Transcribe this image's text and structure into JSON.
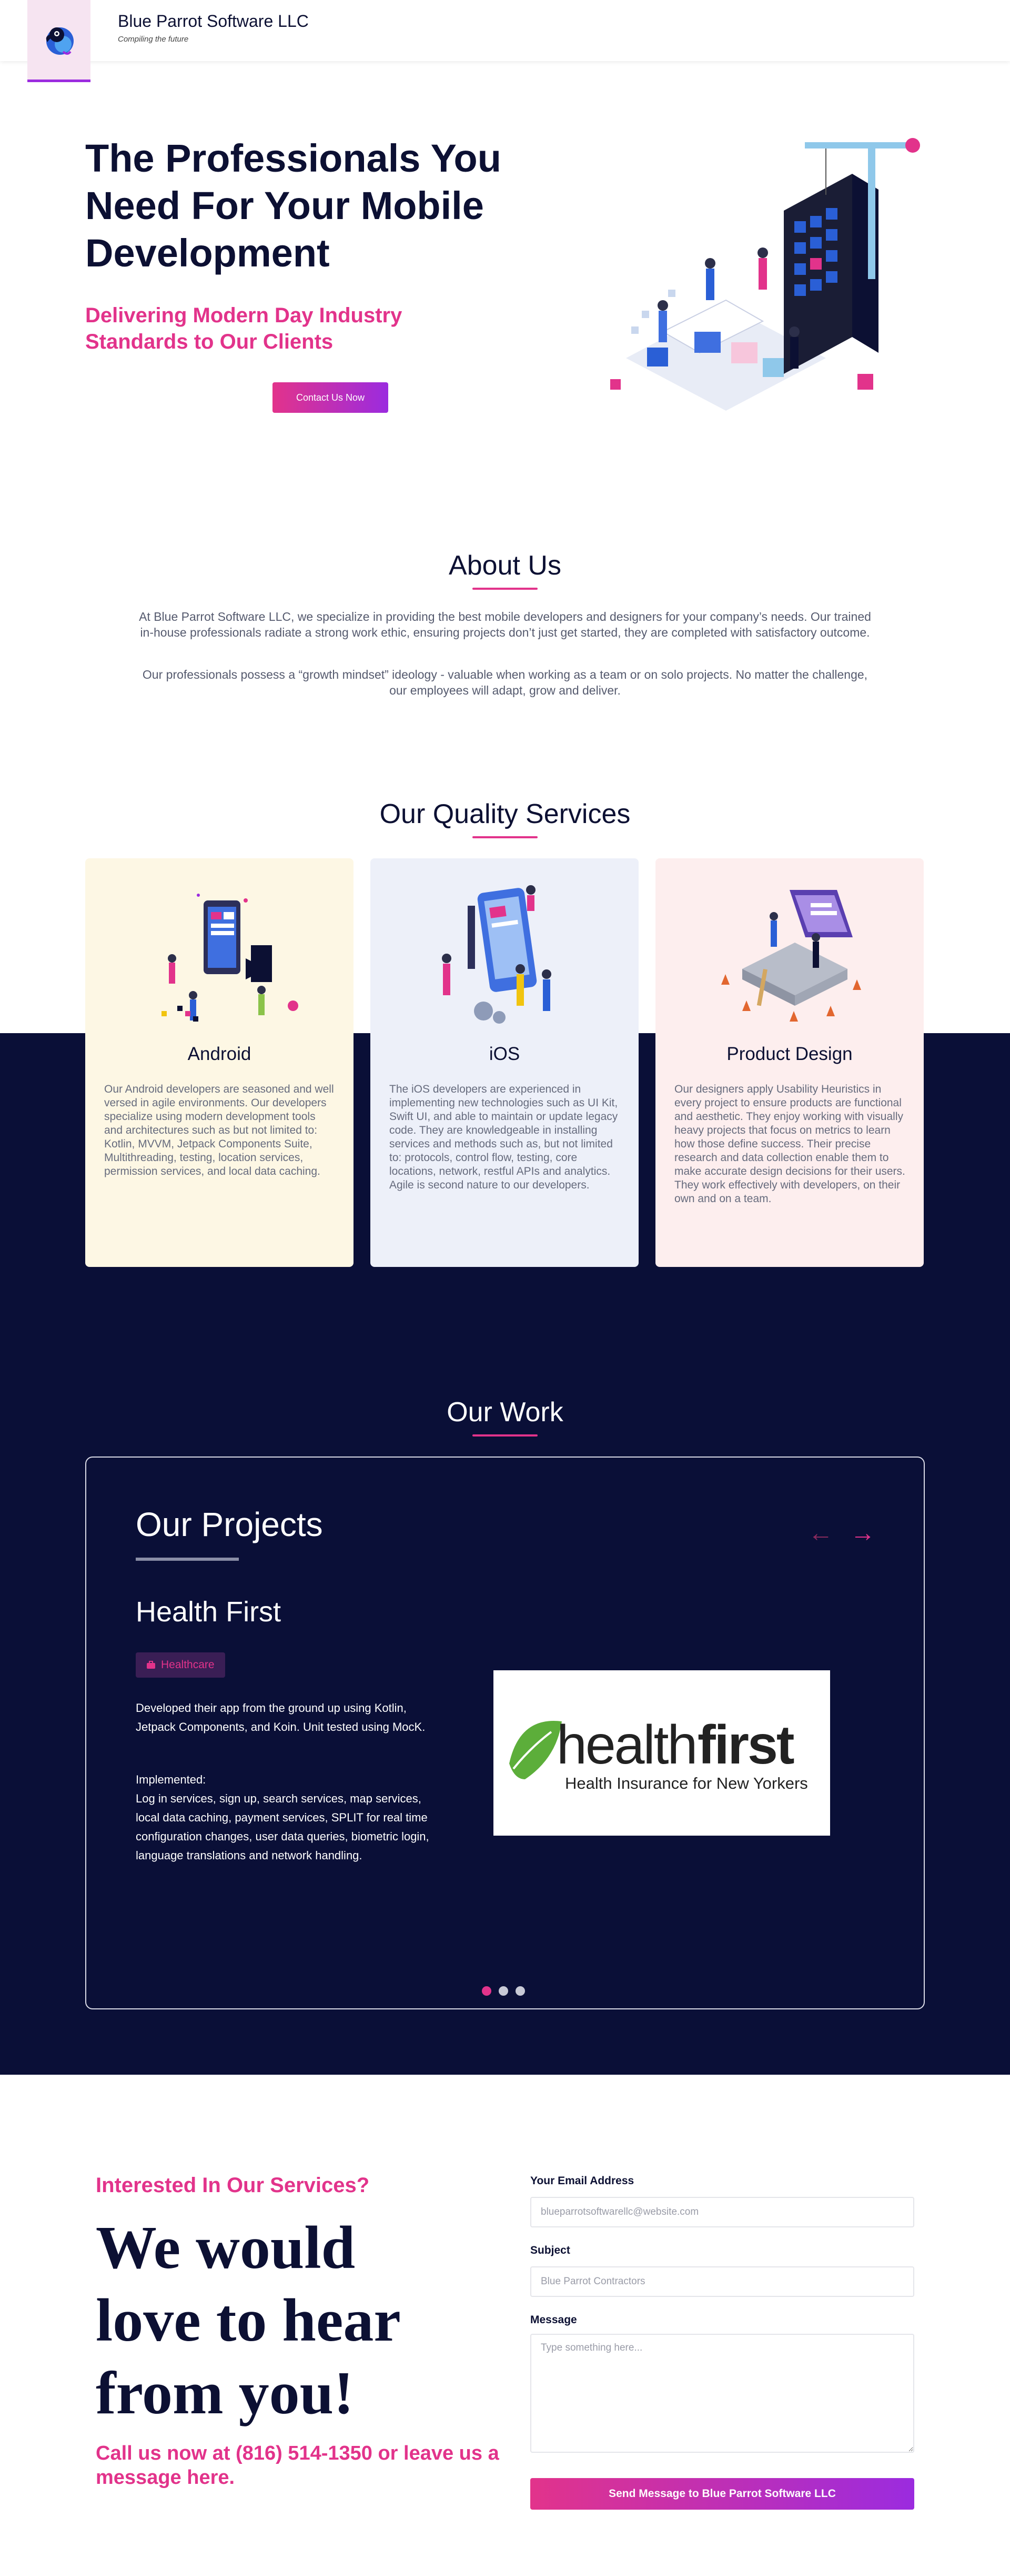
{
  "header": {
    "brand": "Blue Parrot Software LLC",
    "tagline": "Compiling the future"
  },
  "hero": {
    "title": "The Professionals You Need For Your Mobile Development",
    "subtitle": "Delivering Modern Day Industry Standards to Our Clients",
    "cta": "Contact Us Now"
  },
  "about": {
    "title": "About Us",
    "p1": "At Blue Parrot Software LLC, we specialize in providing the best mobile developers and designers for your company’s needs. Our trained in-house professionals radiate a strong work ethic, ensuring projects don’t just get started, they are completed with satisfactory outcome.",
    "p2": "Our professionals possess a “growth mindset” ideology - valuable when working as a team or on solo projects. No matter the challenge, our employees will adapt, grow and deliver."
  },
  "services": {
    "title": "Our Quality Services",
    "cards": [
      {
        "title": "Android",
        "text": "Our Android developers are seasoned and well versed in agile environments. Our developers specialize using modern development tools and architectures such as but not limited to: Kotlin, MVVM, Jetpack Components Suite, Multithreading, testing, location services, permission services, and local data caching.",
        "bg": "#fdf7e4"
      },
      {
        "title": "iOS",
        "text": "The iOS developers are experienced in implementing new technologies such as UI Kit, Swift UI, and able to maintain or update legacy code. They are knowledgeable in installing services and methods such as, but not limited to: protocols, control flow, testing, core locations, network, restful APIs and analytics. Agile is second nature to our developers.",
        "bg": "#edf0f9"
      },
      {
        "title": "Product Design",
        "text": "Our designers apply Usability Heuristics in every project to ensure products are functional and aesthetic. They enjoy working with visually heavy projects that focus on metrics to learn how those define success. Their precise research and data collection enable them to make accurate design decisions for their users. They work effectively with developers, on their own and on a team.",
        "bg": "#fdeeee"
      }
    ]
  },
  "work": {
    "title": "Our Work",
    "heading": "Our Projects",
    "project": {
      "name": "Health First",
      "tag": "Healthcare",
      "desc1": "Developed their app from the ground up using Kotlin, Jetpack Components, and Koin. Unit tested using MocK.",
      "implemented_label": "Implemented:",
      "desc2": "Log in services, sign up, search services, map services, local data caching, payment services, SPLIT for real time configuration changes, user data queries, biometric login, language translations and network handling.",
      "logo_word_light": "health",
      "logo_word_bold": "first",
      "logo_tagline": "Health Insurance for New Yorkers"
    },
    "slides": 3,
    "active_slide": 1
  },
  "contact": {
    "kicker": "Interested In Our Services?",
    "big": "We would love to hear from you!",
    "call": "Call us now at (816) 514-1350 or leave us a message here.",
    "email_label": "Your Email Address",
    "email_placeholder": "blueparrotsoftwarellc@website.com",
    "subject_label": "Subject",
    "subject_placeholder": "Blue Parrot Contractors",
    "message_label": "Message",
    "message_placeholder": "Type something here...",
    "send": "Send Message to Blue Parrot Software LLC"
  },
  "colors": {
    "navy": "#0a0f37",
    "pink": "#e2338b",
    "purple": "#9b2bdf"
  }
}
